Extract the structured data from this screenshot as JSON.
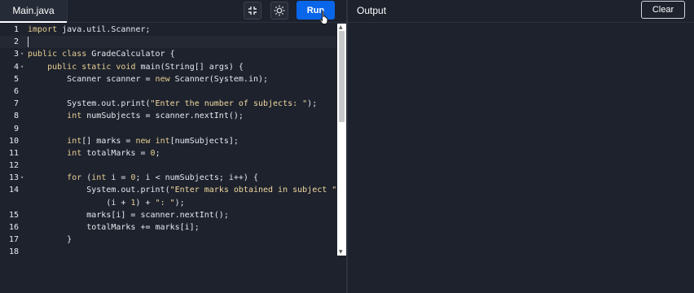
{
  "editor": {
    "file_tab": "Main.java",
    "minimize_icon": "minimize-icon",
    "theme_icon": "sun-icon",
    "run_label": "Run",
    "lines": [
      {
        "n": "1",
        "fold": false
      },
      {
        "n": "2",
        "fold": false
      },
      {
        "n": "3",
        "fold": true
      },
      {
        "n": "4",
        "fold": true
      },
      {
        "n": "5",
        "fold": false
      },
      {
        "n": "6",
        "fold": false
      },
      {
        "n": "7",
        "fold": false
      },
      {
        "n": "8",
        "fold": false
      },
      {
        "n": "9",
        "fold": false
      },
      {
        "n": "10",
        "fold": false
      },
      {
        "n": "11",
        "fold": false
      },
      {
        "n": "12",
        "fold": false
      },
      {
        "n": "13",
        "fold": true
      },
      {
        "n": "14",
        "fold": false
      },
      {
        "n": "",
        "fold": false
      },
      {
        "n": "15",
        "fold": false
      },
      {
        "n": "16",
        "fold": false
      },
      {
        "n": "17",
        "fold": false
      },
      {
        "n": "18",
        "fold": false
      }
    ],
    "code": [
      [
        {
          "t": "import",
          "c": "kw"
        },
        {
          "t": " java.util.Scanner;",
          "c": ""
        }
      ],
      [],
      [
        {
          "t": "public class",
          "c": "kw"
        },
        {
          "t": " GradeCalculator {",
          "c": ""
        }
      ],
      [
        {
          "t": "    ",
          "c": ""
        },
        {
          "t": "public static void",
          "c": "kw"
        },
        {
          "t": " main(String[] args) {",
          "c": ""
        }
      ],
      [
        {
          "t": "        Scanner scanner = ",
          "c": ""
        },
        {
          "t": "new",
          "c": "kw"
        },
        {
          "t": " Scanner(System.in);",
          "c": ""
        }
      ],
      [],
      [
        {
          "t": "        System.out.print(",
          "c": ""
        },
        {
          "t": "\"Enter the number of subjects: \"",
          "c": "str"
        },
        {
          "t": ");",
          "c": ""
        }
      ],
      [
        {
          "t": "        ",
          "c": ""
        },
        {
          "t": "int",
          "c": "ty"
        },
        {
          "t": " numSubjects = scanner.nextInt();",
          "c": ""
        }
      ],
      [],
      [
        {
          "t": "        ",
          "c": ""
        },
        {
          "t": "int",
          "c": "ty"
        },
        {
          "t": "[] marks = ",
          "c": ""
        },
        {
          "t": "new",
          "c": "kw"
        },
        {
          "t": " ",
          "c": ""
        },
        {
          "t": "int",
          "c": "ty"
        },
        {
          "t": "[numSubjects];",
          "c": ""
        }
      ],
      [
        {
          "t": "        ",
          "c": ""
        },
        {
          "t": "int",
          "c": "ty"
        },
        {
          "t": " totalMarks = ",
          "c": ""
        },
        {
          "t": "0",
          "c": "num"
        },
        {
          "t": ";",
          "c": ""
        }
      ],
      [],
      [
        {
          "t": "        ",
          "c": ""
        },
        {
          "t": "for",
          "c": "kw"
        },
        {
          "t": " (",
          "c": ""
        },
        {
          "t": "int",
          "c": "ty"
        },
        {
          "t": " i = ",
          "c": ""
        },
        {
          "t": "0",
          "c": "num"
        },
        {
          "t": "; i < numSubjects; i++) {",
          "c": ""
        }
      ],
      [
        {
          "t": "            System.out.print(",
          "c": ""
        },
        {
          "t": "\"Enter marks obtained in subject \"",
          "c": "str"
        },
        {
          "t": " +",
          "c": ""
        }
      ],
      [
        {
          "t": "                (i + ",
          "c": ""
        },
        {
          "t": "1",
          "c": "num"
        },
        {
          "t": ") + ",
          "c": ""
        },
        {
          "t": "\": \"",
          "c": "str"
        },
        {
          "t": ");",
          "c": ""
        }
      ],
      [
        {
          "t": "            marks[i] = scanner.nextInt();",
          "c": ""
        }
      ],
      [
        {
          "t": "            totalMarks += marks[i];",
          "c": ""
        }
      ],
      [
        {
          "t": "        }",
          "c": ""
        }
      ],
      []
    ]
  },
  "output": {
    "title": "Output",
    "clear_label": "Clear"
  }
}
